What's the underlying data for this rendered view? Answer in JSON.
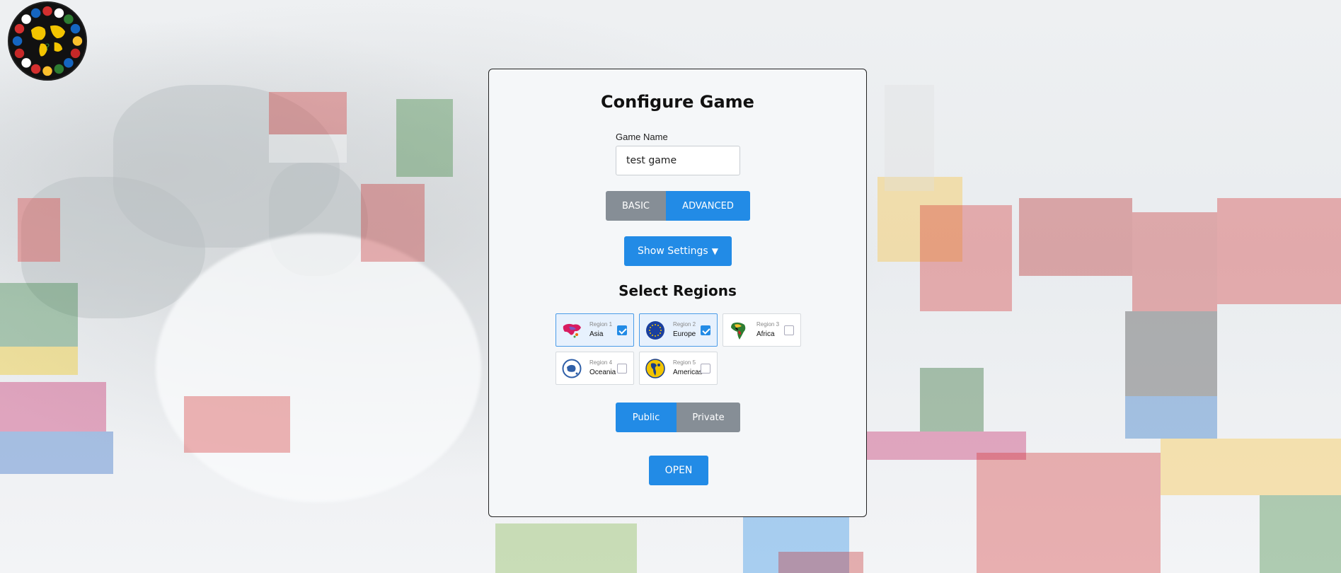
{
  "app": {
    "logo_icon": "world-flags-logo-icon"
  },
  "panel": {
    "title": "Configure Game",
    "game_name_label": "Game Name",
    "game_name_value": "test game",
    "mode_tabs": [
      {
        "label": "BASIC",
        "active": false
      },
      {
        "label": "ADVANCED",
        "active": true
      }
    ],
    "show_settings_label": "Show Settings",
    "show_settings_icon": "triangle-down-icon",
    "regions_title": "Select Regions",
    "regions": [
      {
        "number_label": "Region 1",
        "name": "Asia",
        "checked": true,
        "icon": "asia-map-icon"
      },
      {
        "number_label": "Region 2",
        "name": "Europe",
        "checked": true,
        "icon": "europe-flag-icon"
      },
      {
        "number_label": "Region 3",
        "name": "Africa",
        "checked": false,
        "icon": "africa-map-icon"
      },
      {
        "number_label": "Region 4",
        "name": "Oceania",
        "checked": false,
        "icon": "oceania-icon"
      },
      {
        "number_label": "Region 5",
        "name": "Americas",
        "checked": false,
        "icon": "americas-icon"
      }
    ],
    "visibility": [
      {
        "label": "Public",
        "active": true
      },
      {
        "label": "Private",
        "active": false
      }
    ],
    "open_label": "OPEN"
  },
  "colors": {
    "primary": "#228be6",
    "secondary": "#868e96",
    "panel_bg": "#f5f7f9"
  }
}
